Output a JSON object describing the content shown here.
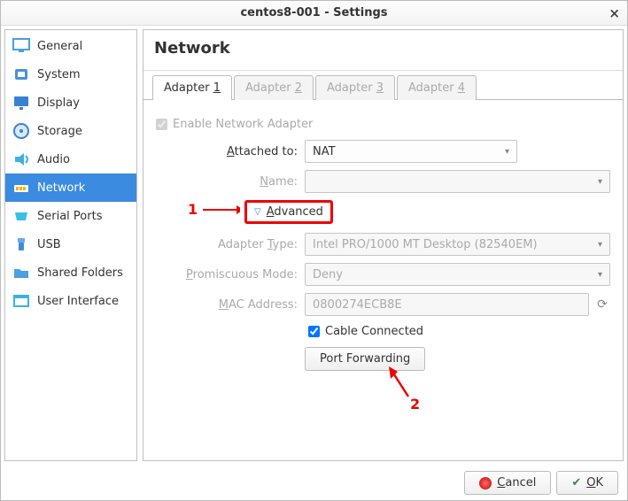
{
  "window": {
    "title": "centos8-001 - Settings"
  },
  "sidebar": {
    "items": [
      {
        "label": "General"
      },
      {
        "label": "System"
      },
      {
        "label": "Display"
      },
      {
        "label": "Storage"
      },
      {
        "label": "Audio"
      },
      {
        "label": "Network"
      },
      {
        "label": "Serial Ports"
      },
      {
        "label": "USB"
      },
      {
        "label": "Shared Folders"
      },
      {
        "label": "User Interface"
      }
    ]
  },
  "main": {
    "title": "Network"
  },
  "tabs": [
    {
      "label": "Adapter ",
      "num": "1"
    },
    {
      "label": "Adapter ",
      "num": "2"
    },
    {
      "label": "Adapter ",
      "num": "3"
    },
    {
      "label": "Adapter ",
      "num": "4"
    }
  ],
  "form": {
    "enable_label": "Enable Network Adapter",
    "attached_label": "Attached to:",
    "attached_value": "NAT",
    "name_label": "Name:",
    "name_value": "",
    "advanced_label": "Advanced",
    "adapter_type_label": "Adapter Type:",
    "adapter_type_value": "Intel PRO/1000 MT Desktop (82540EM)",
    "promiscuous_label": "Promiscuous Mode:",
    "promiscuous_value": "Deny",
    "mac_label": "MAC Address:",
    "mac_value": "0800274ECB8E",
    "cable_label": "Cable Connected",
    "port_forwarding_label": "Port Forwarding"
  },
  "buttons": {
    "cancel": "Cancel",
    "ok": "OK"
  },
  "annotations": {
    "one": "1",
    "two": "2"
  }
}
